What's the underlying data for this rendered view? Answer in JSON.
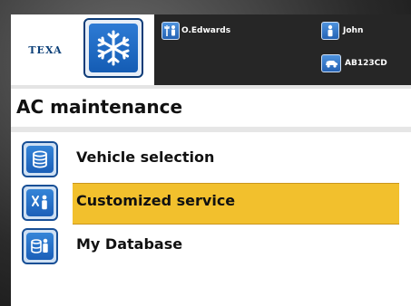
{
  "header": {
    "brand": "TEXA",
    "app_icon": "snowflake-icon",
    "operator": {
      "icon": "wrench-person-icon",
      "name": "O.Edwards"
    },
    "customer": {
      "icon": "person-icon",
      "name": "John"
    },
    "vehicle": {
      "icon": "car-icon",
      "plate": "AB123CD"
    }
  },
  "page": {
    "title": "AC maintenance"
  },
  "menu": {
    "items": [
      {
        "label": "Vehicle selection",
        "icon": "database-icon",
        "selected": false
      },
      {
        "label": "Customized service",
        "icon": "tools-person-icon",
        "selected": true
      },
      {
        "label": "My Database",
        "icon": "database-person-icon",
        "selected": false
      }
    ]
  },
  "colors": {
    "accent_blue": "#1b5fb8",
    "selection_yellow": "#f2c02d",
    "header_dark": "#262626"
  }
}
